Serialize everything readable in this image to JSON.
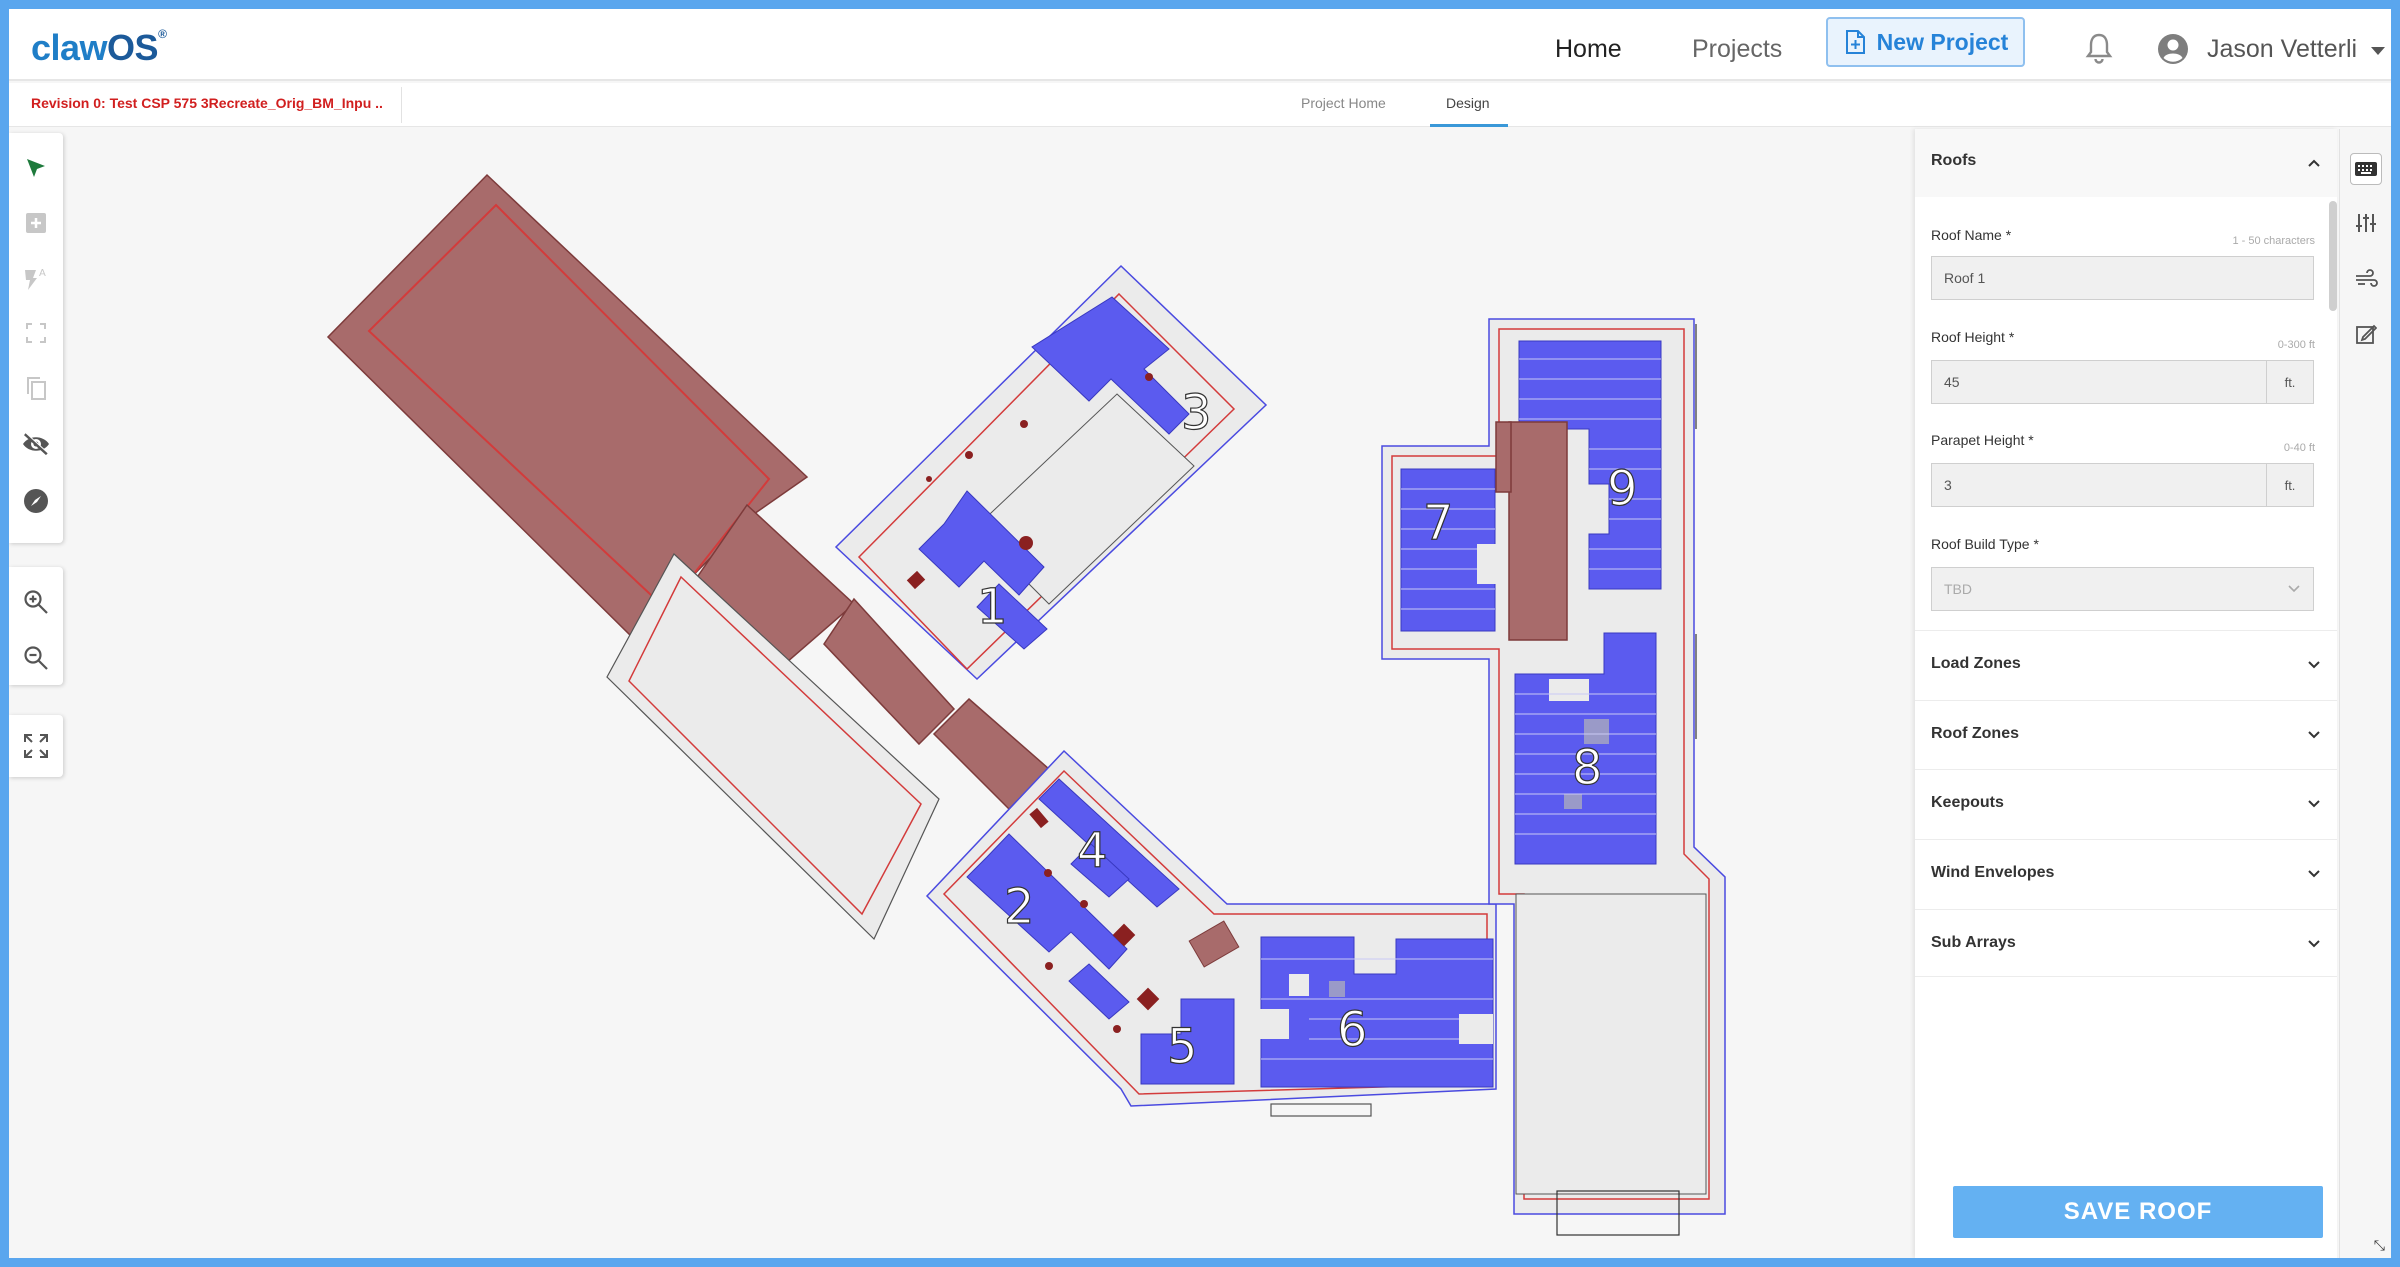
{
  "app": {
    "logo_part1": "claw",
    "logo_part2": "OS",
    "logo_mark": "®",
    "nav": {
      "home": "Home",
      "projects": "Projects",
      "new_project": "New Project",
      "user_name": "Jason Vetterli"
    }
  },
  "subheader": {
    "revision": "Revision 0: Test CSP 575 3Recreate_Orig_BM_Inpu ..",
    "tabs": [
      "Project Home",
      "Design"
    ],
    "active_tab": "Design"
  },
  "left_toolbar": {
    "tools": [
      "select-arrow-icon",
      "add-icon",
      "auto-layout-icon",
      "selection-frame-icon",
      "copy-icon",
      "hide-icon",
      "compass-icon"
    ],
    "zoom_tools": [
      "zoom-in-icon",
      "zoom-out-icon"
    ],
    "fit_tool": "fit-screen-icon"
  },
  "canvas": {
    "roof_labels": [
      "1",
      "2",
      "3",
      "4",
      "5",
      "6",
      "7",
      "8",
      "9"
    ],
    "colors": {
      "solar_array": "#5b5bef",
      "building": "#a86a6a",
      "roof_fill": "#ebebeb",
      "outline_red": "#e24848",
      "outline_blue": "#4a4ae0"
    }
  },
  "panel": {
    "title": "Roofs",
    "fields": {
      "roof_name": {
        "label": "Roof Name *",
        "hint": "1 - 50 characters",
        "value": "Roof 1"
      },
      "roof_height": {
        "label": "Roof Height *",
        "hint": "0-300 ft",
        "value": "45",
        "unit": "ft."
      },
      "parapet_height": {
        "label": "Parapet Height *",
        "hint": "0-40 ft",
        "value": "3",
        "unit": "ft."
      },
      "build_type": {
        "label": "Roof Build Type *",
        "value": "TBD"
      }
    },
    "sections": [
      "Load Zones",
      "Roof Zones",
      "Keepouts",
      "Wind Envelopes",
      "Sub Arrays"
    ],
    "save_label": "SAVE ROOF"
  },
  "right_rail": {
    "icons": [
      "keyboard-icon",
      "sliders-icon",
      "wind-icon",
      "edit-icon"
    ]
  }
}
